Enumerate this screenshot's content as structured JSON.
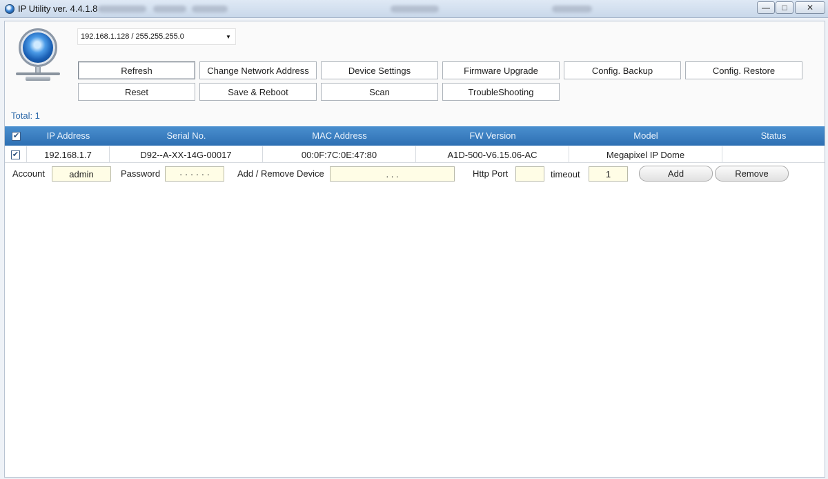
{
  "window": {
    "title": "IP Utility ver. 4.4.1.8",
    "minimize_glyph": "—",
    "maximize_glyph": "□",
    "close_glyph": "✕"
  },
  "network": {
    "selected": "192.168.1.128 / 255.255.255.0",
    "arrow": "▼"
  },
  "toolbar": {
    "refresh": "Refresh",
    "change_network_address": "Change Network Address",
    "device_settings": "Device Settings",
    "firmware_upgrade": "Firmware Upgrade",
    "config_backup": "Config. Backup",
    "config_restore": "Config. Restore",
    "reset": "Reset",
    "save_reboot": "Save & Reboot",
    "scan": "Scan",
    "troubleshooting": "TroubleShooting"
  },
  "total_label": "Total: 1",
  "table": {
    "columns": [
      "IP Address",
      "Serial No.",
      "MAC Address",
      "FW Version",
      "Model",
      "Status"
    ],
    "rows": [
      {
        "checked": true,
        "ip": "192.168.1.7",
        "serial": "D92--A-XX-14G-00017",
        "mac": "00:0F:7C:0E:47:80",
        "fw": "A1D-500-V6.15.06-AC",
        "model": "Megapixel IP Dome",
        "status": ""
      }
    ],
    "check_glyph": "✔"
  },
  "add_remove": {
    "account_label": "Account",
    "account_value": "admin",
    "password_label": "Password",
    "password_value": "· · · · · ·",
    "device_label": "Add / Remove Device",
    "device_value": ".           .           .",
    "http_port_label": "Http Port",
    "http_port_value": "",
    "timeout_label": "timeout",
    "timeout_value": "1",
    "add_button": "Add",
    "remove_button": "Remove"
  },
  "colors": {
    "header_blue": "#3a7fc2",
    "input_yellow": "#fffde6",
    "total_text": "#2a67a8"
  }
}
